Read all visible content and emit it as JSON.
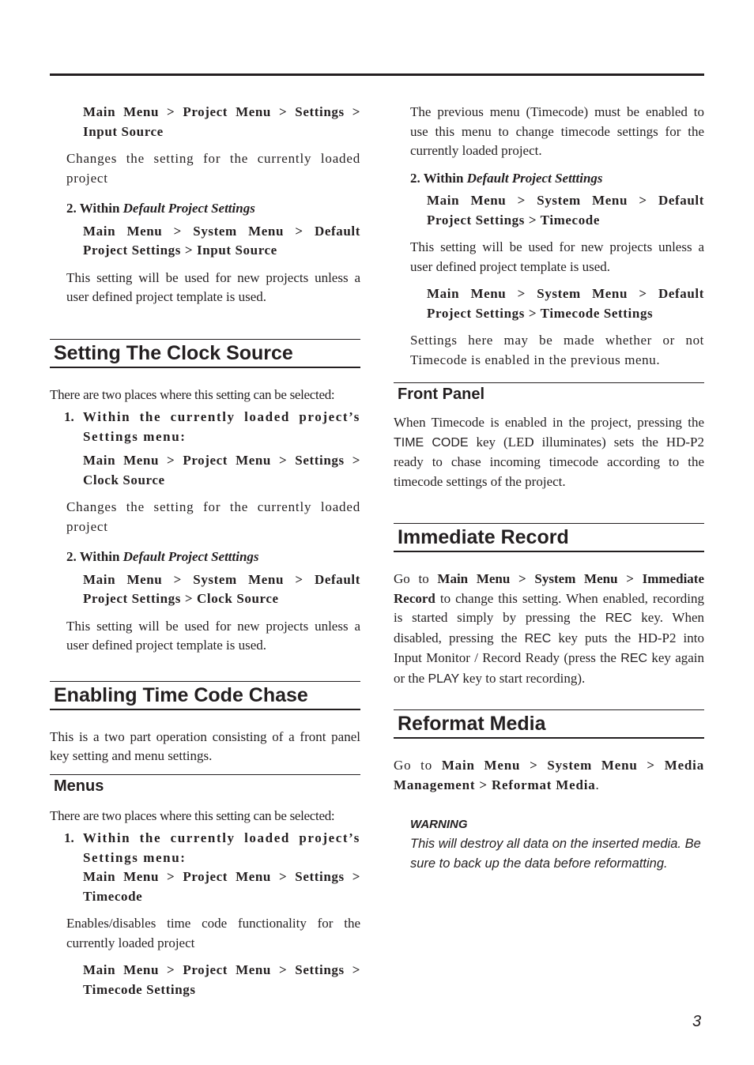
{
  "page_number": "3",
  "left_column": {
    "intro_menu_path": "Main Menu > Project Menu > Settings > Input Source",
    "intro_desc": "Changes the setting for the currently loaded project",
    "intro_sub_prefix": "2. Within ",
    "intro_sub_italic": "Default Project Settings",
    "intro_menu_path2": "Main Menu > System Menu > Default Project Settings > Input Source",
    "intro_desc2": "This setting will be used for new projects unless a user defined project template is used.",
    "clock": {
      "heading": "Setting The Clock Source",
      "intro": "There are two places where this setting can be selected:",
      "item1_num": "1.",
      "item1_text": "Within the currently loaded project’s Settings menu:",
      "menu_path1": "Main Menu > Project Menu > Settings > Clock Source",
      "desc1": "Changes the setting for the currently loaded project",
      "sub_prefix": "2. Within ",
      "sub_italic": "Default Project Setttings",
      "menu_path2": "Main Menu > System Menu > Default Project Settings > Clock Source",
      "desc2": "This setting will be used for new projects unless a user defined project template is used."
    },
    "timecode": {
      "heading": "Enabling Time Code Chase",
      "intro": "This is a two part operation consisting of a front panel key setting and menu settings.",
      "menus_heading": "Menus",
      "menus_intro": "There are two places where this setting can be selected:",
      "item1_num": "1.",
      "item1_text": "Within the currently loaded project’s Settings menu:",
      "menu_path1": "Main Menu > Project Menu > Settings > Timecode",
      "desc1": "Enables/disables time code functionality for the currently loaded project",
      "menu_path2": "Main Menu > Project Menu > Settings > Timecode Settings"
    }
  },
  "right_column": {
    "cont_desc": "The previous menu (Timecode) must be enabled to use this menu to change timecode settings for the currently loaded project.",
    "sub_prefix": "2. Within ",
    "sub_italic": "Default Project Setttings",
    "menu_path1": "Main Menu > System Menu > Default Project Settings > Timecode",
    "desc1": "This setting will be used for new projects unless a user defined project template is used.",
    "menu_path2": "Main Menu > System Menu > Default Project Settings > Timecode Settings",
    "desc2": "Settings here may be made whether or not Timecode is enabled in the previous menu.",
    "front_panel": {
      "heading": "Front Panel",
      "text_a": "When Timecode is enabled in the project, pressing the ",
      "key": "TIME CODE",
      "text_b": " key (LED illuminates) sets the HD-P2 ready to chase incoming timecode according to the timecode settings of the project."
    },
    "immediate": {
      "heading": "Immediate Record",
      "t1": "Go to ",
      "path": "Main Menu > System Menu > Immediate Record",
      "t2": " to change this setting. When enabled, recording is started simply by pressing the ",
      "key1": "REC",
      "t3": " key. When disabled, pressing the ",
      "key2": "REC",
      "t4": " key puts the HD-P2 into Input Monitor / Record Ready (press the ",
      "key3": "REC",
      "t5": " key again or the ",
      "key4": "PLAY",
      "t6": " key to start recording)."
    },
    "reformat": {
      "heading": "Reformat Media",
      "t1": "Go to ",
      "path": "Main Menu > System Menu > Media Management > Reformat Media",
      "t2": ".",
      "warning_title": "WARNING",
      "warning_text": "This will destroy all data on the inserted media. Be sure to back up the data before reformatting."
    }
  }
}
